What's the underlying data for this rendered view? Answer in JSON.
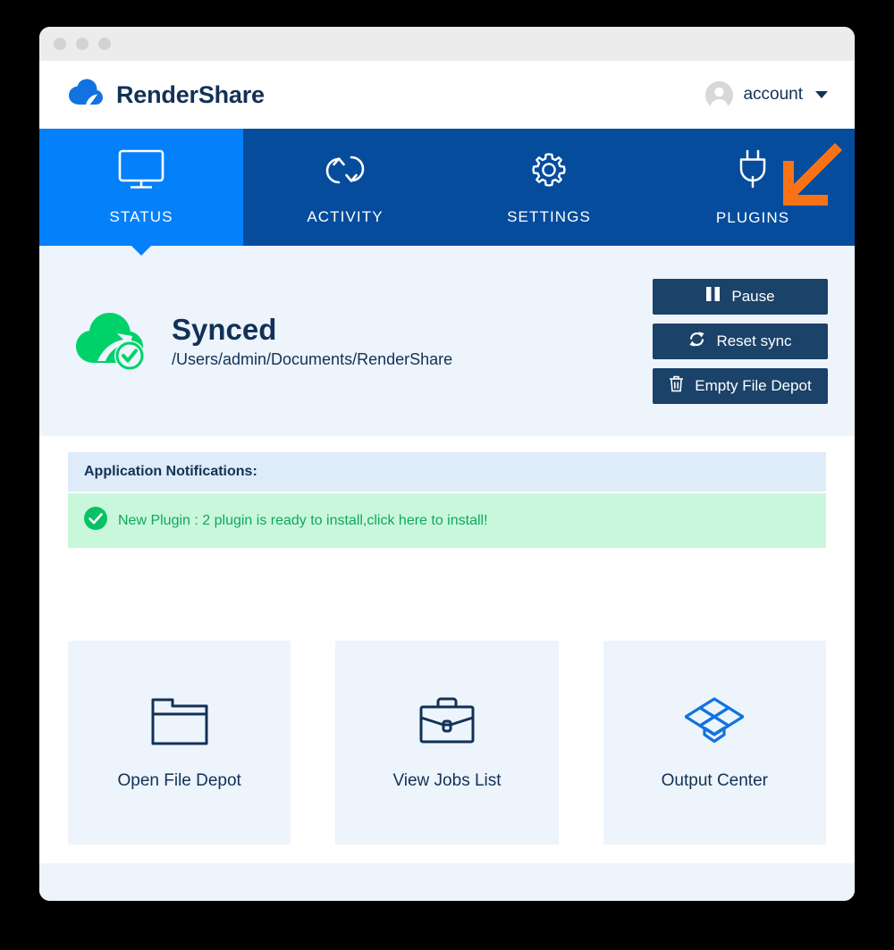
{
  "window": {
    "traffic_lights": [
      "close",
      "minimize",
      "zoom"
    ]
  },
  "header": {
    "logo_icon": "cloud-logo-icon",
    "brand_name": "RenderShare",
    "account": {
      "avatar_icon": "user-avatar-icon",
      "label": "account",
      "caret_icon": "chevron-down-icon"
    }
  },
  "nav": {
    "tabs": [
      {
        "id": "status",
        "label": "STATUS",
        "icon": "monitor-icon",
        "active": true
      },
      {
        "id": "activity",
        "label": "ACTIVITY",
        "icon": "sync-arrows-icon",
        "active": false
      },
      {
        "id": "settings",
        "label": "SETTINGS",
        "icon": "gear-icon",
        "active": false
      },
      {
        "id": "plugins",
        "label": "PLUGINS",
        "icon": "plug-icon",
        "active": false
      }
    ],
    "annotation_arrow": "orange-arrow-pointing-to-plugins",
    "colors": {
      "active_tab": "#0480FB",
      "inactive_tab": "#054C9D",
      "annotation_arrow": "#F97316"
    }
  },
  "status": {
    "icon": "green-cloud-check-icon",
    "state": "Synced",
    "path": "/Users/admin/Documents/RenderShare",
    "panel_color": "#EDF4FC",
    "actions": [
      {
        "id": "pause",
        "label": "Pause",
        "icon": "pause-icon"
      },
      {
        "id": "reset-sync",
        "label": "Reset sync",
        "icon": "refresh-icon"
      },
      {
        "id": "empty-depot",
        "label": "Empty File Depot",
        "icon": "trash-icon"
      }
    ]
  },
  "notifications": {
    "header": "Application Notifications:",
    "items": [
      {
        "id": "new-plugin",
        "icon": "check-circle-icon",
        "text": "New Plugin : 2 plugin is ready to install,click here to install!",
        "color": "#0FA958"
      }
    ]
  },
  "cards": [
    {
      "id": "open-file-depot",
      "label": "Open File Depot",
      "icon": "folder-icon"
    },
    {
      "id": "view-jobs-list",
      "label": "View Jobs List",
      "icon": "briefcase-icon"
    },
    {
      "id": "output-center",
      "label": "Output Center",
      "icon": "open-box-icon"
    }
  ]
}
